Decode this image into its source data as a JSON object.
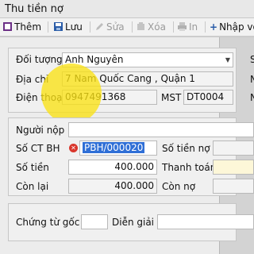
{
  "window": {
    "title": "Thu tiền nợ"
  },
  "toolbar": {
    "add_label": "Thêm",
    "save_label": "Lưu",
    "edit_label": "Sửa",
    "delete_label": "Xóa",
    "print_label": "In",
    "import_label": "Nhập vo"
  },
  "customer": {
    "subject_label": "Đối tượng",
    "subject_value": "Anh Nguyên",
    "address_label": "Địa chỉ",
    "address_value": "7 Nam Quốc Cang , Quận 1",
    "phone_label": "Điện thoại",
    "phone_value": "0947491368",
    "mst_label": "MST",
    "mst_value": "DT0004",
    "right_labels": [
      "S",
      "N",
      "N"
    ]
  },
  "payment": {
    "payer_label": "Người nộp",
    "payer_value": "",
    "voucher_label": "Số CT BH",
    "voucher_value": "PBH/000020",
    "debt_amount_label": "Số tiền nợ",
    "amount_label": "Số tiền",
    "amount_value": "400.000",
    "payment_label": "Thanh toán",
    "remaining_label": "Còn lại",
    "remaining_value": "400.000",
    "owed_label": "Còn nợ"
  },
  "notes": {
    "origin_doc_label": "Chứng từ gốc",
    "origin_doc_value": "",
    "description_label": "Diễn giải",
    "description_value": ""
  },
  "colors": {
    "highlight": "#fae114",
    "selection": "#2f6fd6",
    "error_icon": "#d9362c"
  }
}
